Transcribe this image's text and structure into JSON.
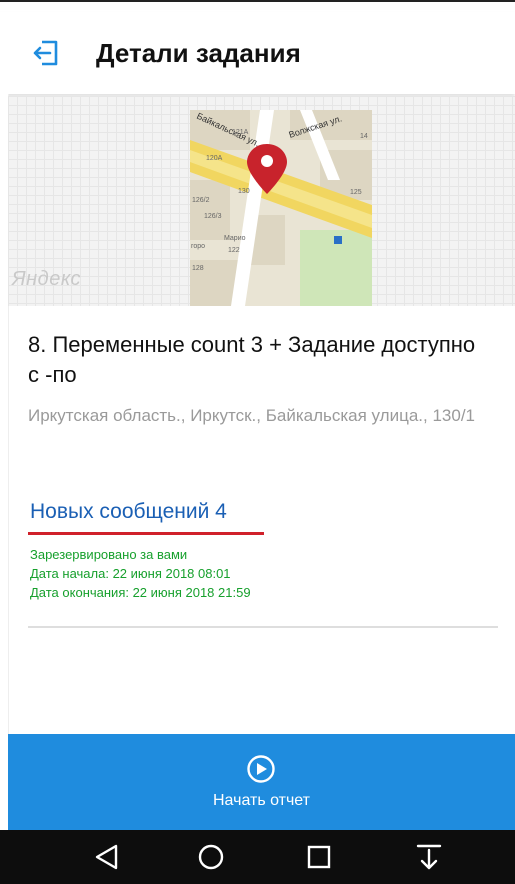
{
  "header": {
    "title": "Детали задания",
    "back_icon": "exit-icon"
  },
  "map": {
    "watermark": "Яндекс",
    "labels": {
      "street1": "Байкальская ул.",
      "street2": "Волжская ул.",
      "b121a": "121А",
      "b120a": "120А",
      "b130": "130",
      "b126_2": "126/2",
      "b126_3": "126/3",
      "b125": "125",
      "b128": "128",
      "b14": "14",
      "b122": "122",
      "mario": "Марио",
      "goro": "горо"
    }
  },
  "task": {
    "title": "8. Переменные count 3 + Задание доступно с -по",
    "address": "Иркутская область., Иркутск., Байкальская улица., 130/1"
  },
  "messages": {
    "label": "Новых сообщений 4"
  },
  "status": {
    "reserved": "Зарезервировано за вами",
    "start": "Дата начала: 22 июня 2018 08:01",
    "end": "Дата окончания: 22 июня 2018 21:59"
  },
  "action": {
    "label": "Начать отчет"
  },
  "colors": {
    "accent": "#1f8cde",
    "link": "#1a5fb4",
    "status": "#17a02d",
    "underline": "#d0202a"
  }
}
